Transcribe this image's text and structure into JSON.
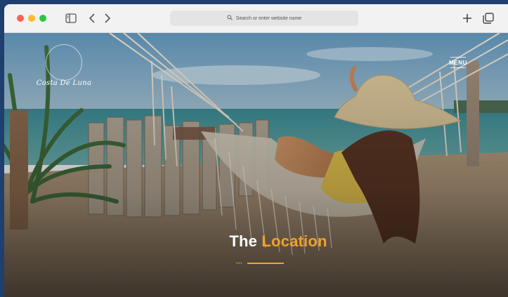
{
  "browser": {
    "address_placeholder": "Search or enter website name",
    "icons": {
      "sidebar": "sidebar-icon",
      "back": "chevron-left-icon",
      "forward": "chevron-right-icon",
      "search": "search-icon",
      "new_tab": "plus-icon",
      "tabs": "tab-overview-icon"
    }
  },
  "site": {
    "logo_text": "Costa De Luna",
    "menu_label": "MENU",
    "heading_prefix": "The",
    "heading_accent": "Location",
    "accent_color": "#f2a12a"
  }
}
